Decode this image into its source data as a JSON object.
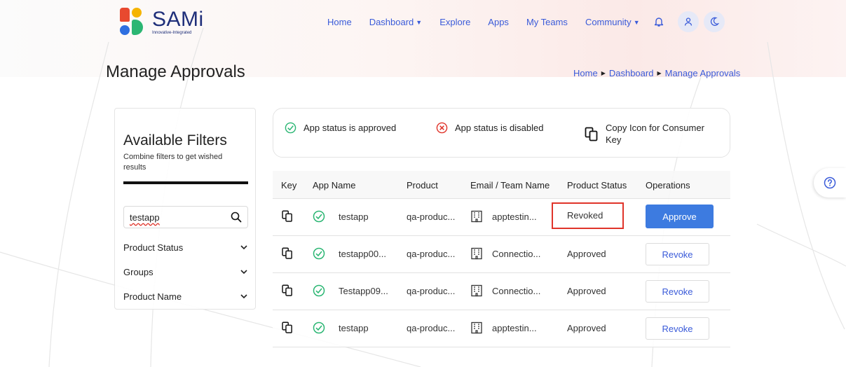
{
  "brand": {
    "name": "SAMi",
    "tagline": "Innovative-Integrated"
  },
  "nav": {
    "items": [
      {
        "label": "Home",
        "has_dropdown": false
      },
      {
        "label": "Dashboard",
        "has_dropdown": true
      },
      {
        "label": "Explore",
        "has_dropdown": false
      },
      {
        "label": "Apps",
        "has_dropdown": false
      },
      {
        "label": "My Teams",
        "has_dropdown": false
      },
      {
        "label": "Community",
        "has_dropdown": true
      }
    ],
    "icons": [
      "bell-icon",
      "user-icon",
      "moon-icon"
    ]
  },
  "page": {
    "title": "Manage Approvals"
  },
  "breadcrumb": [
    "Home",
    "Dashboard",
    "Manage Approvals"
  ],
  "filters": {
    "title": "Available Filters",
    "subtitle": "Combine filters to get wished results",
    "search_value": "testapp",
    "groups": [
      "Product Status",
      "Groups",
      "Product Name"
    ]
  },
  "legend": {
    "approved": "App status is approved",
    "disabled": "App status is disabled",
    "copy_line1": "Copy Icon for Consumer",
    "copy_line2": "Key"
  },
  "table": {
    "headers": [
      "Key",
      "App Name",
      "Product",
      "Email / Team Name",
      "Product Status",
      "Operations"
    ],
    "rows": [
      {
        "app_name": "testapp",
        "product": "qa-produc...",
        "team": "apptestin...",
        "status": "Revoked",
        "operation": "Approve"
      },
      {
        "app_name": "testapp00...",
        "product": "qa-produc...",
        "team": "Connectio...",
        "status": "Approved",
        "operation": "Revoke"
      },
      {
        "app_name": "Testapp09...",
        "product": "qa-produc...",
        "team": "Connectio...",
        "status": "Approved",
        "operation": "Revoke"
      },
      {
        "app_name": "testapp",
        "product": "qa-produc...",
        "team": "apptestin...",
        "status": "Approved",
        "operation": "Revoke"
      }
    ]
  },
  "colors": {
    "accent": "#3a5bd9",
    "approve_button": "#3d7be0",
    "approved_icon": "#2bb673",
    "disabled_icon": "#e0342a",
    "highlight_box": "#e0342a"
  }
}
